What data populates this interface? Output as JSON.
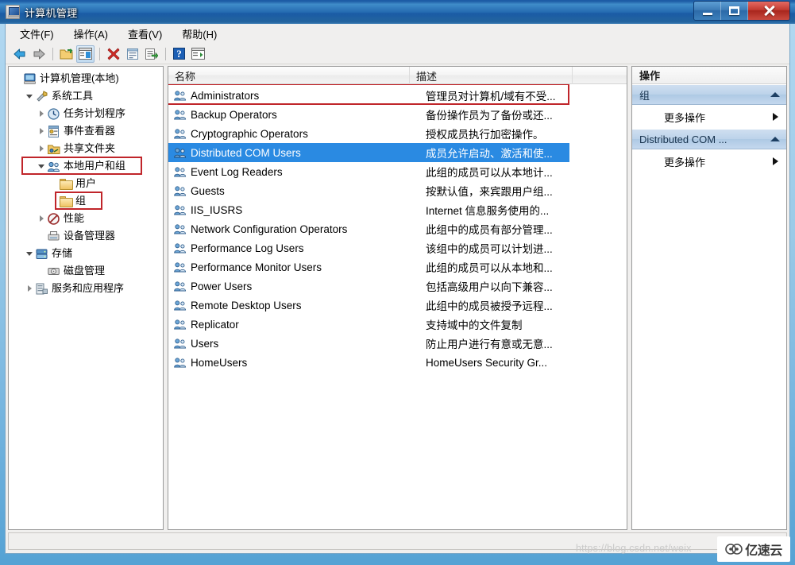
{
  "window": {
    "title": "计算机管理",
    "icon": "computer-management-icon",
    "buttons": {
      "minimize": "最小化",
      "maximize": "最大化",
      "close": "关闭"
    }
  },
  "menubar": {
    "items": [
      {
        "label": "文件(F)",
        "name": "menu-file"
      },
      {
        "label": "操作(A)",
        "name": "menu-action"
      },
      {
        "label": "查看(V)",
        "name": "menu-view"
      },
      {
        "label": "帮助(H)",
        "name": "menu-help"
      }
    ]
  },
  "toolbar": {
    "buttons": [
      {
        "name": "back-button",
        "icon": "arrow-left-icon",
        "pressed": false
      },
      {
        "name": "forward-button",
        "icon": "arrow-right-icon",
        "pressed": false
      },
      {
        "name": "up-folder-button",
        "icon": "folder-up-icon",
        "pressed": false
      },
      {
        "name": "show-hide-tree-button",
        "icon": "console-tree-icon",
        "pressed": true
      },
      {
        "name": "delete-button",
        "icon": "red-x-icon",
        "pressed": false
      },
      {
        "name": "properties-button",
        "icon": "properties-icon",
        "pressed": false
      },
      {
        "name": "export-list-button",
        "icon": "export-list-icon",
        "pressed": false
      },
      {
        "name": "help-button",
        "icon": "question-mark-icon",
        "pressed": false
      },
      {
        "name": "show-action-pane-button",
        "icon": "action-pane-icon",
        "pressed": false
      }
    ]
  },
  "tree": {
    "nodes": [
      {
        "label": "计算机管理(本地)",
        "indent": 0,
        "twist": "none",
        "icon": "computer-icon",
        "name": "tree-computer-management-local",
        "highlight": false
      },
      {
        "label": "系统工具",
        "indent": 1,
        "twist": "open",
        "icon": "system-tools-icon",
        "name": "tree-system-tools",
        "highlight": false
      },
      {
        "label": "任务计划程序",
        "indent": 2,
        "twist": "closed",
        "icon": "task-scheduler-icon",
        "name": "tree-task-scheduler",
        "highlight": false
      },
      {
        "label": "事件查看器",
        "indent": 2,
        "twist": "closed",
        "icon": "event-viewer-icon",
        "name": "tree-event-viewer",
        "highlight": false
      },
      {
        "label": "共享文件夹",
        "indent": 2,
        "twist": "closed",
        "icon": "shared-folders-icon",
        "name": "tree-shared-folders",
        "highlight": false
      },
      {
        "label": "本地用户和组",
        "indent": 2,
        "twist": "open",
        "icon": "local-users-groups-icon",
        "name": "tree-local-users-and-groups",
        "highlight": true
      },
      {
        "label": "用户",
        "indent": 3,
        "twist": "none",
        "icon": "folder-icon",
        "name": "tree-users",
        "highlight": false
      },
      {
        "label": "组",
        "indent": 3,
        "twist": "none",
        "icon": "folder-icon",
        "name": "tree-groups",
        "highlight": true
      },
      {
        "label": "性能",
        "indent": 2,
        "twist": "closed",
        "icon": "performance-icon",
        "name": "tree-performance",
        "highlight": false
      },
      {
        "label": "设备管理器",
        "indent": 2,
        "twist": "none",
        "icon": "device-manager-icon",
        "name": "tree-device-manager",
        "highlight": false
      },
      {
        "label": "存储",
        "indent": 1,
        "twist": "open",
        "icon": "storage-icon",
        "name": "tree-storage",
        "highlight": false
      },
      {
        "label": "磁盘管理",
        "indent": 2,
        "twist": "none",
        "icon": "disk-management-icon",
        "name": "tree-disk-management",
        "highlight": false
      },
      {
        "label": "服务和应用程序",
        "indent": 1,
        "twist": "closed",
        "icon": "services-apps-icon",
        "name": "tree-services-and-applications",
        "highlight": false
      }
    ]
  },
  "list": {
    "columns": [
      {
        "label": "名称",
        "name": "column-name"
      },
      {
        "label": "描述",
        "name": "column-description"
      }
    ],
    "rows": [
      {
        "name": "Administrators",
        "description": "管理员对计算机/域有不受...",
        "selected": false,
        "highlight": true
      },
      {
        "name": "Backup Operators",
        "description": "备份操作员为了备份或还...",
        "selected": false,
        "highlight": false
      },
      {
        "name": "Cryptographic Operators",
        "description": "授权成员执行加密操作。",
        "selected": false,
        "highlight": false
      },
      {
        "name": "Distributed COM Users",
        "description": "成员允许启动、激活和使...",
        "selected": true,
        "highlight": false
      },
      {
        "name": "Event Log Readers",
        "description": "此组的成员可以从本地计...",
        "selected": false,
        "highlight": false
      },
      {
        "name": "Guests",
        "description": "按默认值，来宾跟用户组...",
        "selected": false,
        "highlight": false
      },
      {
        "name": "IIS_IUSRS",
        "description": "Internet 信息服务使用的...",
        "selected": false,
        "highlight": false
      },
      {
        "name": "Network Configuration Operators",
        "description": "此组中的成员有部分管理...",
        "selected": false,
        "highlight": false
      },
      {
        "name": "Performance Log Users",
        "description": "该组中的成员可以计划进...",
        "selected": false,
        "highlight": false
      },
      {
        "name": "Performance Monitor Users",
        "description": "此组的成员可以从本地和...",
        "selected": false,
        "highlight": false
      },
      {
        "name": "Power Users",
        "description": "包括高级用户以向下兼容...",
        "selected": false,
        "highlight": false
      },
      {
        "name": "Remote Desktop Users",
        "description": "此组中的成员被授予远程...",
        "selected": false,
        "highlight": false
      },
      {
        "name": "Replicator",
        "description": "支持域中的文件复制",
        "selected": false,
        "highlight": false
      },
      {
        "name": "Users",
        "description": "防止用户进行有意或无意...",
        "selected": false,
        "highlight": false
      },
      {
        "name": "HomeUsers",
        "description": "HomeUsers Security Gr...",
        "selected": false,
        "highlight": false
      }
    ]
  },
  "actions": {
    "title": "操作",
    "sections": [
      {
        "heading": "组",
        "name": "actions-section-groups",
        "item": "更多操作",
        "item_name": "more-actions-groups"
      },
      {
        "heading": "Distributed COM ...",
        "name": "actions-section-dcom",
        "item": "更多操作",
        "item_name": "more-actions-dcom"
      }
    ]
  },
  "watermark": {
    "url": "https://blog.csdn.net/weix",
    "brand": "亿速云"
  },
  "colors": {
    "selection": "#2a8ae2",
    "highlight_box": "#c0252a",
    "title_bar": "#1c5aa4",
    "action_header": "#bcd3ea"
  }
}
